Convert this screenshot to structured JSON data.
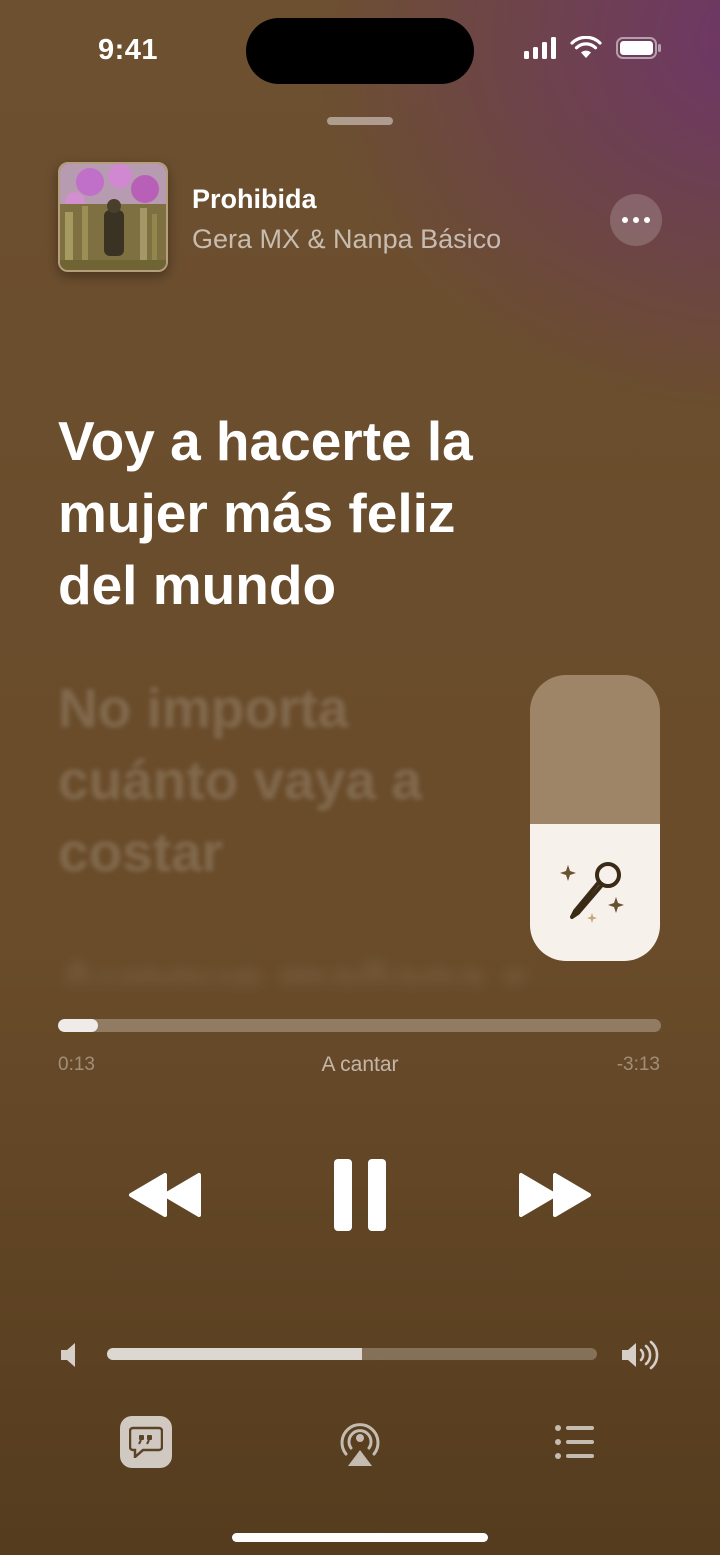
{
  "status_bar": {
    "time": "9:41",
    "icons": [
      "cellular-signal-icon",
      "wifi-icon",
      "battery-icon"
    ]
  },
  "now_playing": {
    "title": "Prohibida",
    "artist": "Gera MX & Nanpa Básico",
    "more_icon": "ellipsis-icon"
  },
  "lyrics": {
    "active_lines": [
      "Voy a hacerte la",
      "mujer más feliz",
      "del mundo"
    ],
    "next_lines": [
      "No importa",
      "cuánto vaya a",
      "costar"
    ],
    "faded_line": "Aunque mañana se"
  },
  "vocal_slider": {
    "level": 0.48,
    "icon": "sparkle-microphone-icon"
  },
  "playback": {
    "elapsed": "0:13",
    "remaining": "-3:13",
    "mode_label": "A cantar",
    "progress": 0.066
  },
  "transport": {
    "rewind_icon": "backward-icon",
    "pause_icon": "pause-icon",
    "forward_icon": "forward-icon"
  },
  "volume": {
    "level": 0.52,
    "low_icon": "speaker-low-icon",
    "high_icon": "speaker-high-icon"
  },
  "toolbar": {
    "items": [
      "lyrics-icon",
      "airplay-icon",
      "queue-list-icon"
    ],
    "active": "lyrics-icon"
  },
  "colors": {
    "background_top": "#6d5030",
    "background_bottom": "#553c1e",
    "accent_purple": "#6e346c",
    "vocal_fill": "#f6f1ea"
  }
}
